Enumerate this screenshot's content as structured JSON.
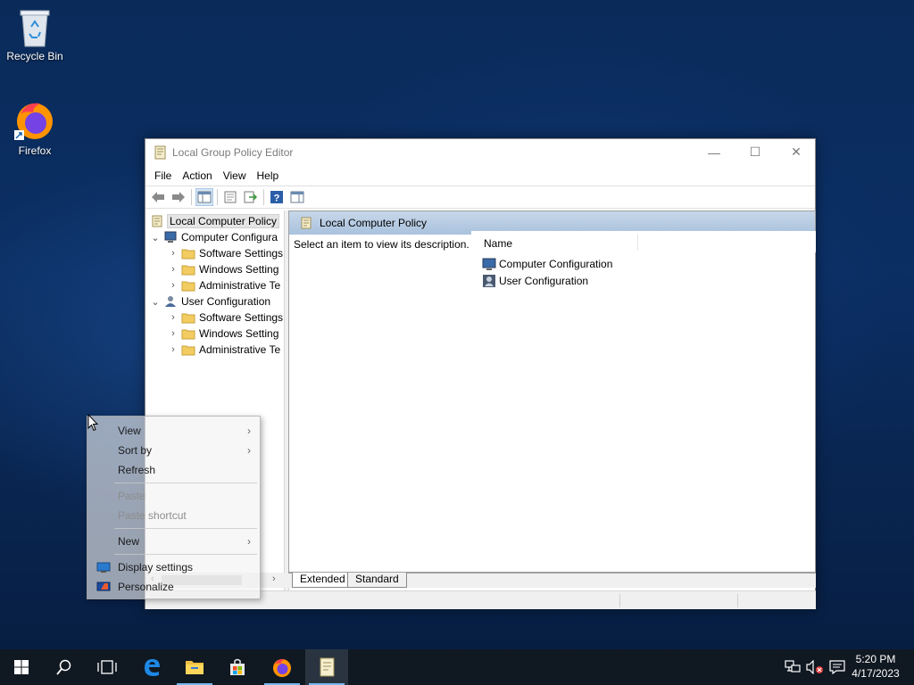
{
  "desktop": {
    "icons": [
      {
        "label": "Recycle Bin",
        "icon": "recycle-bin-icon"
      },
      {
        "label": "Firefox",
        "icon": "firefox-icon"
      }
    ]
  },
  "window": {
    "title": "Local Group Policy Editor",
    "menu": [
      "File",
      "Action",
      "View",
      "Help"
    ],
    "tree": {
      "root": "Local Computer Policy",
      "computer": "Computer Configura",
      "computer_children": [
        "Software Settings",
        "Windows Setting",
        "Administrative Te"
      ],
      "user": "User Configuration",
      "user_children": [
        "Software Settings",
        "Windows Setting",
        "Administrative Te"
      ]
    },
    "banner_title": "Local Computer Policy",
    "description": "Select an item to view its description.",
    "list_header": "Name",
    "list_items": [
      "Computer Configuration",
      "User Configuration"
    ],
    "tabs": [
      "Extended",
      "Standard"
    ],
    "active_tab": "Extended"
  },
  "context_menu": {
    "items": [
      {
        "label": "View",
        "submenu": true,
        "disabled": false
      },
      {
        "label": "Sort by",
        "submenu": true,
        "disabled": false
      },
      {
        "label": "Refresh",
        "submenu": false,
        "disabled": false
      },
      {
        "label": "Paste",
        "submenu": false,
        "disabled": true
      },
      {
        "label": "Paste shortcut",
        "submenu": false,
        "disabled": true
      },
      {
        "label": "New",
        "submenu": true,
        "disabled": false
      },
      {
        "label": "Display settings",
        "submenu": false,
        "disabled": false
      },
      {
        "label": "Personalize",
        "submenu": false,
        "disabled": false
      }
    ]
  },
  "taskbar": {
    "time": "5:20 PM",
    "date": "4/17/2023",
    "apps": [
      "start-icon",
      "search-icon",
      "task-view-icon",
      "edge-icon",
      "file-explorer-icon",
      "store-icon",
      "firefox-icon",
      "policy-editor-icon"
    ]
  },
  "colors": {
    "accent": "#76b9ed",
    "taskbar": "#101822",
    "banner": "#a9c2dd"
  }
}
